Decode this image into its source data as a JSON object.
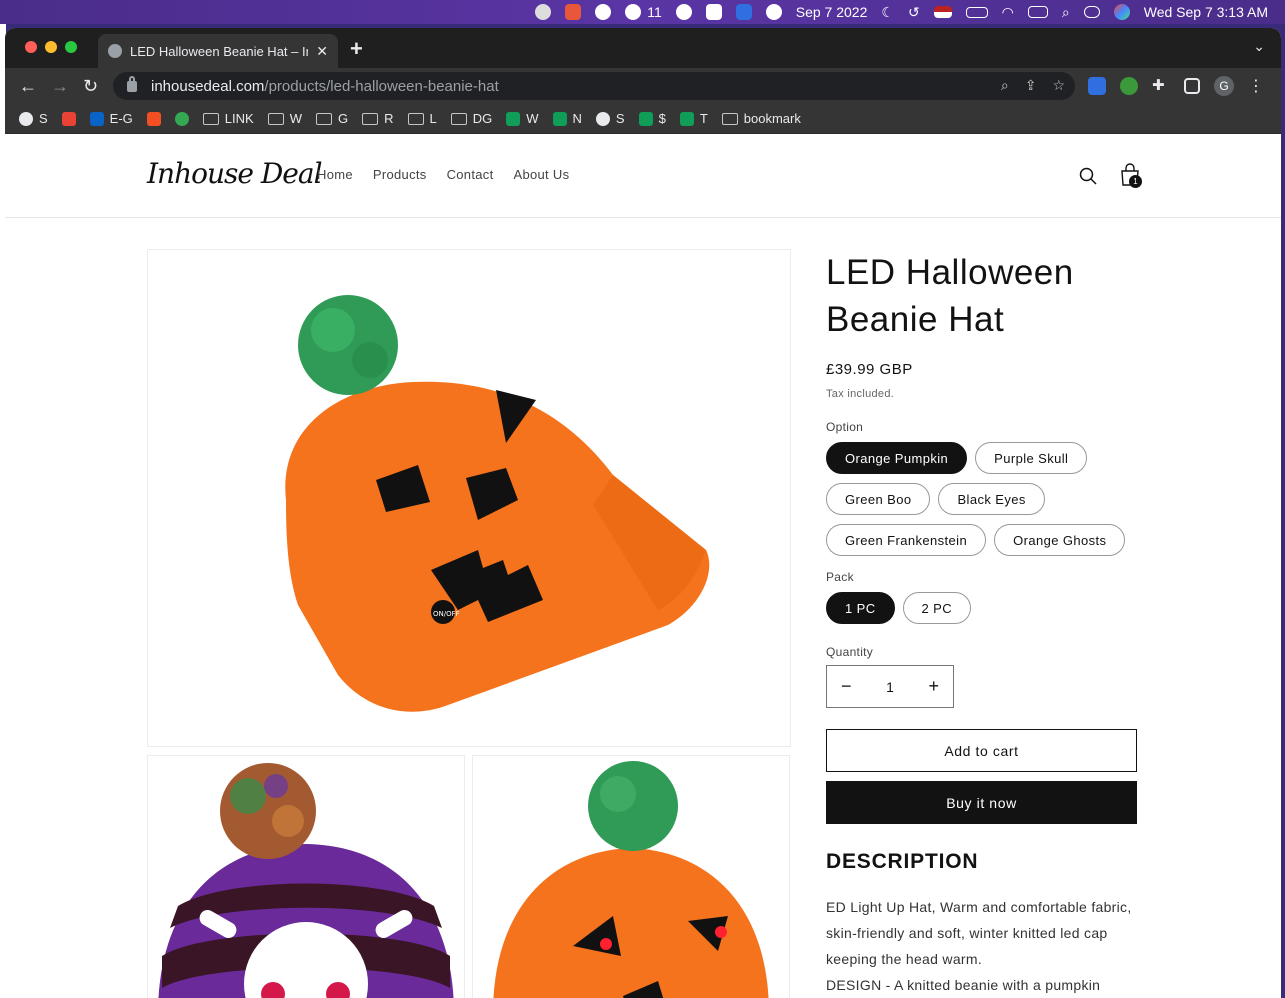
{
  "menubar": {
    "wechat_count": "11",
    "date": "Sep 7 2022",
    "clock": "Wed Sep 7  3:13 AM"
  },
  "browser": {
    "tab_title": "LED Halloween Beanie Hat – In",
    "url_host": "inhousedeal.com",
    "url_path": "/products/led-halloween-beanie-hat",
    "profile_initial": "G",
    "bookmarks": [
      {
        "label": "S",
        "icon": "globe-icon"
      },
      {
        "label": "",
        "icon": "gmail-icon"
      },
      {
        "label": "E-G",
        "icon": "outlook-icon"
      },
      {
        "label": "",
        "icon": "microsoft-icon"
      },
      {
        "label": "",
        "icon": "g-icon"
      },
      {
        "label": "LINK",
        "icon": "folder-icon"
      },
      {
        "label": "W",
        "icon": "folder-icon"
      },
      {
        "label": "G",
        "icon": "folder-icon"
      },
      {
        "label": "R",
        "icon": "folder-icon"
      },
      {
        "label": "L",
        "icon": "folder-icon"
      },
      {
        "label": "DG",
        "icon": "folder-icon"
      },
      {
        "label": "W",
        "icon": "sheets-icon"
      },
      {
        "label": "N",
        "icon": "sheets-icon"
      },
      {
        "label": "S",
        "icon": "globe-icon"
      },
      {
        "label": "$",
        "icon": "sheets-icon"
      },
      {
        "label": "T",
        "icon": "star-icon"
      },
      {
        "label": "bookmark",
        "icon": "folder-icon"
      }
    ]
  },
  "site": {
    "logo": "Inhouse Deal",
    "nav": [
      "Home",
      "Products",
      "Contact",
      "About Us"
    ],
    "cart_count": "1"
  },
  "product": {
    "title": "LED Halloween Beanie Hat",
    "price": "£39.99 GBP",
    "tax_note": "Tax included.",
    "option_label": "Option",
    "options": [
      "Orange Pumpkin",
      "Purple Skull",
      "Green Boo",
      "Black Eyes",
      "Green Frankenstein",
      "Orange Ghosts"
    ],
    "selected_option": "Orange Pumpkin",
    "pack_label": "Pack",
    "packs": [
      "1 PC",
      "2 PC"
    ],
    "selected_pack": "1 PC",
    "quantity_label": "Quantity",
    "quantity": "1",
    "add_to_cart": "Add to cart",
    "buy_now": "Buy it now",
    "description_heading": "DESCRIPTION",
    "description_lines": [
      "ED Light Up Hat, Warm and comfortable fabric,",
      "skin-friendly and soft, winter knitted led cap",
      "keeping the head warm.",
      "DESIGN - A knitted beanie with a pumpkin ghost"
    ],
    "hat_button_text": "ON/OFF"
  },
  "colors": {
    "pumpkin_orange": "#f5731c",
    "pompom_green": "#2f9b56",
    "skull_purple": "#6a2a9a",
    "button_dark": "#121212"
  }
}
